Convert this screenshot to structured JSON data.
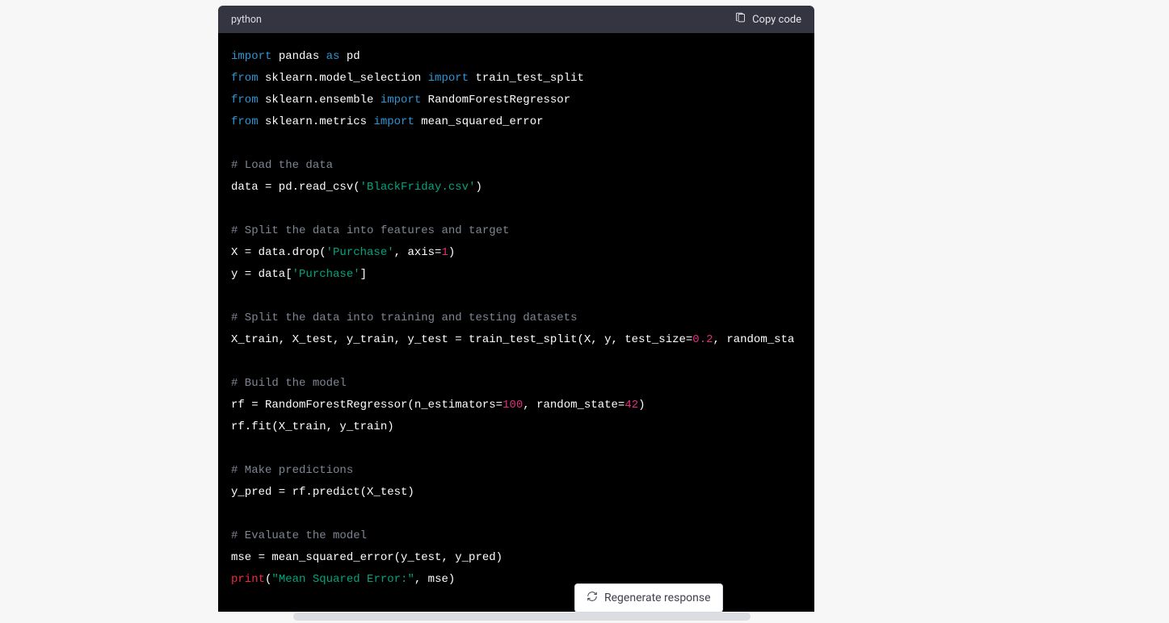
{
  "header": {
    "lang": "python",
    "copy_label": "Copy code"
  },
  "code": {
    "l1_import": "import",
    "l1_pandas": "pandas",
    "l1_as": "as",
    "l1_pd": "pd",
    "l2_from": "from",
    "l2_mod": "sklearn.model_selection",
    "l2_import": "import",
    "l2_name": "train_test_split",
    "l3_from": "from",
    "l3_mod": "sklearn.ensemble",
    "l3_import": "import",
    "l3_name": "RandomForestRegressor",
    "l4_from": "from",
    "l4_mod": "sklearn.metrics",
    "l4_import": "import",
    "l4_name": "mean_squared_error",
    "c_load": "# Load the data",
    "l_load_a": "data = pd.read_csv(",
    "l_load_str": "'BlackFriday.csv'",
    "l_load_b": ")",
    "c_splitft": "# Split the data into features and target",
    "l_X_a": "X = data.drop(",
    "l_X_str": "'Purchase'",
    "l_X_b": ", axis=",
    "l_X_num": "1",
    "l_X_c": ")",
    "l_y_a": "y = data[",
    "l_y_str": "'Purchase'",
    "l_y_b": "]",
    "c_splittt": "# Split the data into training and testing datasets",
    "l_tts_a": "X_train, X_test, y_train, y_test = train_test_split(X, y, test_size=",
    "l_tts_num": "0.2",
    "l_tts_b": ", random_sta",
    "c_build": "# Build the model",
    "l_rf_a": "rf = RandomForestRegressor(n_estimators=",
    "l_rf_n1": "100",
    "l_rf_b": ", random_state=",
    "l_rf_n2": "42",
    "l_rf_c": ")",
    "l_fit": "rf.fit(X_train, y_train)",
    "c_pred": "# Make predictions",
    "l_pred": "y_pred = rf.predict(X_test)",
    "c_eval": "# Evaluate the model",
    "l_mse": "mse = mean_squared_error(y_test, y_pred)",
    "l_print_fn": "print",
    "l_print_a": "(",
    "l_print_str": "\"Mean Squared Error:\"",
    "l_print_b": ", mse)"
  },
  "regen_label": "Regenerate response"
}
